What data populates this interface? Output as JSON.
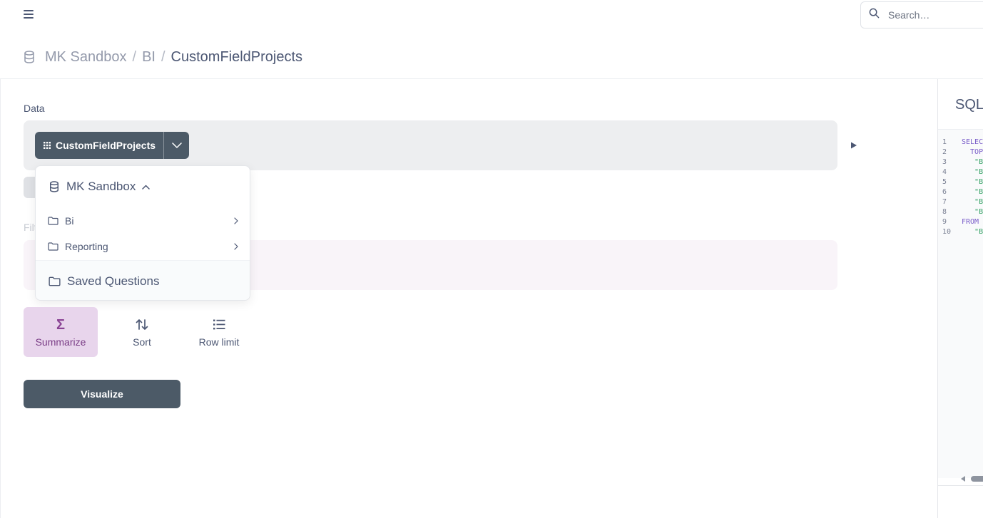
{
  "search": {
    "placeholder": "Search…"
  },
  "breadcrumb": {
    "database": "MK Sandbox",
    "separator": "/",
    "schema": "BI",
    "table": "CustomFieldProjects"
  },
  "notebook": {
    "data_label": "Data",
    "table_pill_label": "CustomFieldProjects",
    "filter_label_partial": "Filt"
  },
  "popover": {
    "database": "MK Sandbox",
    "items": [
      {
        "label": "Bi"
      },
      {
        "label": "Reporting"
      }
    ],
    "saved_questions": "Saved Questions"
  },
  "actions": {
    "summarize": "Summarize",
    "sort": "Sort",
    "row_limit": "Row limit",
    "visualize": "Visualize"
  },
  "sql_panel": {
    "title": "SQL",
    "lines": [
      {
        "n": "1",
        "text": "SELEC",
        "kind": "kw"
      },
      {
        "n": "2",
        "text": "  TOP",
        "kind": "kw"
      },
      {
        "n": "3",
        "text": "   \"BI",
        "kind": "str"
      },
      {
        "n": "4",
        "text": "   \"BI",
        "kind": "str"
      },
      {
        "n": "5",
        "text": "   \"BI",
        "kind": "str"
      },
      {
        "n": "6",
        "text": "   \"BI",
        "kind": "str"
      },
      {
        "n": "7",
        "text": "   \"BI",
        "kind": "str"
      },
      {
        "n": "8",
        "text": "   \"BI",
        "kind": "str"
      },
      {
        "n": "9",
        "text": "FROM",
        "kind": "kw"
      },
      {
        "n": "10",
        "text": "   \"BI",
        "kind": "str"
      }
    ]
  },
  "colors": {
    "accent_summarize": "#8a4394",
    "dark_button": "#4c5a67",
    "text": "#4c5773"
  }
}
